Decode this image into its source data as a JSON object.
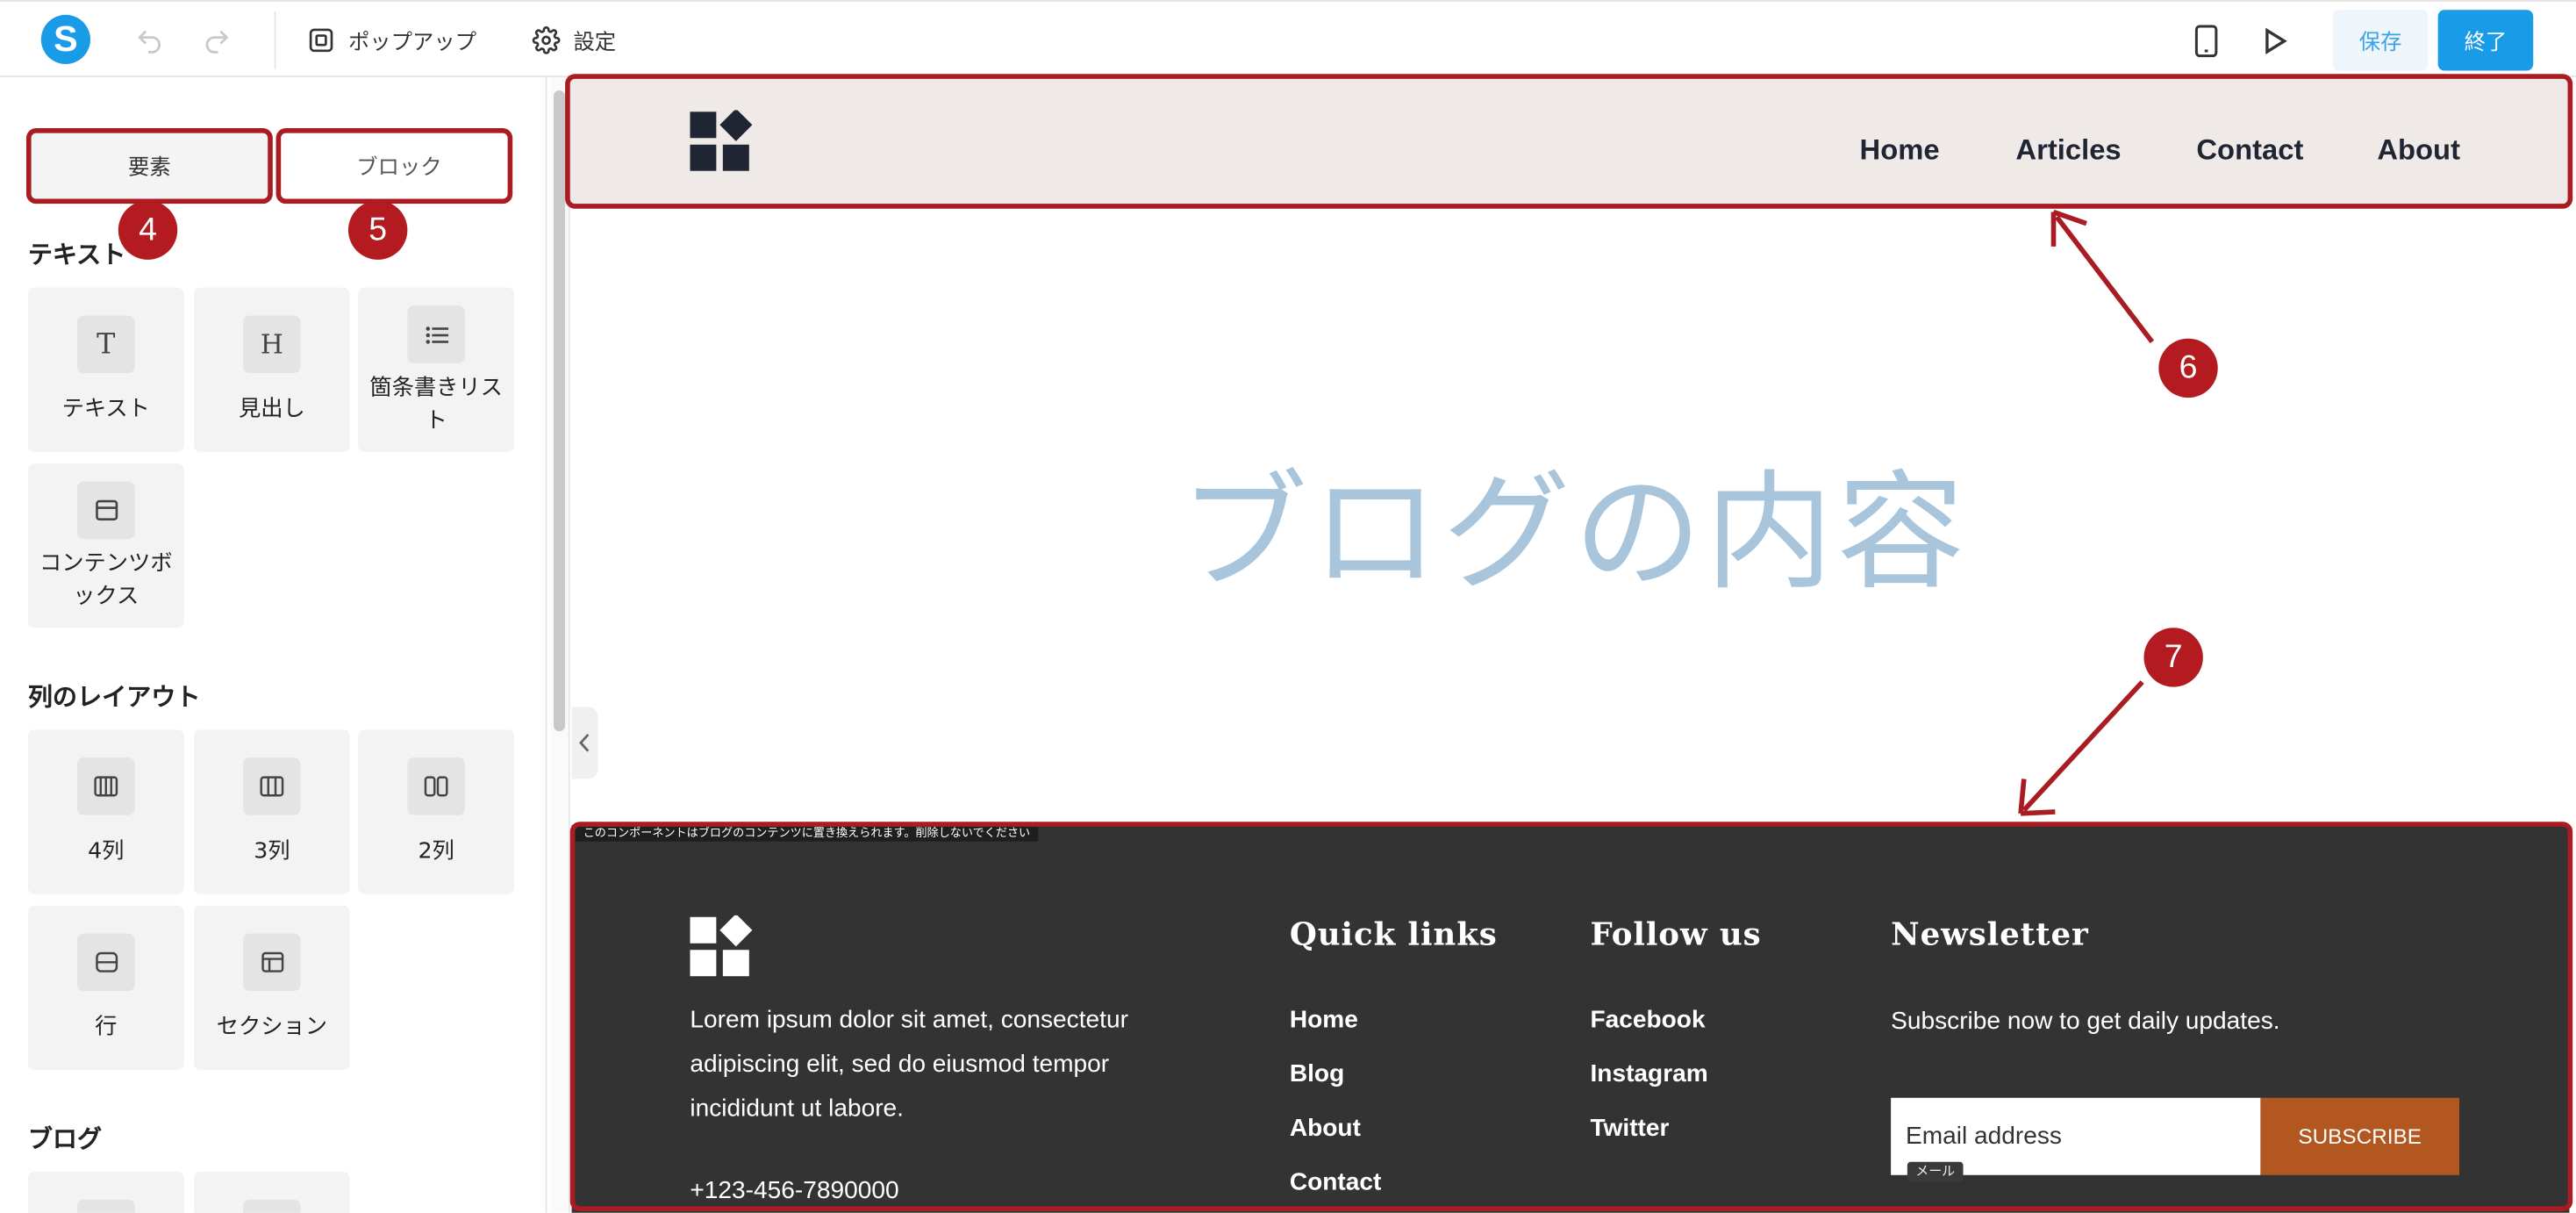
{
  "app": {
    "logo_letter": "S"
  },
  "toolbar": {
    "popup_label": "ポップアップ",
    "settings_label": "設定",
    "save_label": "保存",
    "finish_label": "終了"
  },
  "sidebar": {
    "tabs": [
      {
        "label": "要素"
      },
      {
        "label": "ブロック"
      }
    ],
    "sections": {
      "text": {
        "title": "テキスト",
        "items": [
          "テキスト",
          "見出し",
          "箇条書きリスト",
          "コンテンツボックス"
        ]
      },
      "columns": {
        "title": "列のレイアウト",
        "items": [
          "4列",
          "3列",
          "2列",
          "行",
          "セクション"
        ]
      },
      "blog": {
        "title": "ブログ"
      }
    }
  },
  "annotations": {
    "badges": [
      "4",
      "5",
      "6",
      "7"
    ]
  },
  "site": {
    "nav": [
      "Home",
      "Articles",
      "Contact",
      "About"
    ],
    "content_title": "ブログの内容",
    "footer": {
      "notice": "このコンポーネントはブログのコンテンツに置き換えられます。削除しないでください",
      "about_text_lines": [
        "Lorem ipsum dolor sit amet, consectetur",
        "adipiscing elit, sed do eiusmod tempor",
        "incididunt ut labore."
      ],
      "phone": "+123-456-7890000",
      "quick_links_title": "Quick links",
      "quick_links": [
        "Home",
        "Blog",
        "About",
        "Contact"
      ],
      "follow_title": "Follow us",
      "follow_links": [
        "Facebook",
        "Instagram",
        "Twitter"
      ],
      "newsletter_title": "Newsletter",
      "newsletter_text": "Subscribe now to get daily updates.",
      "email_placeholder": "Email address",
      "subscribe_label": "SUBSCRIBE",
      "email_tag": "メール"
    }
  },
  "colors": {
    "accent": "#1a9be8",
    "annotation": "#a81c22",
    "header_bg": "#efeae7",
    "footer_bg": "#333333",
    "subscribe": "#b35720",
    "content_title": "#a9c5dc"
  }
}
